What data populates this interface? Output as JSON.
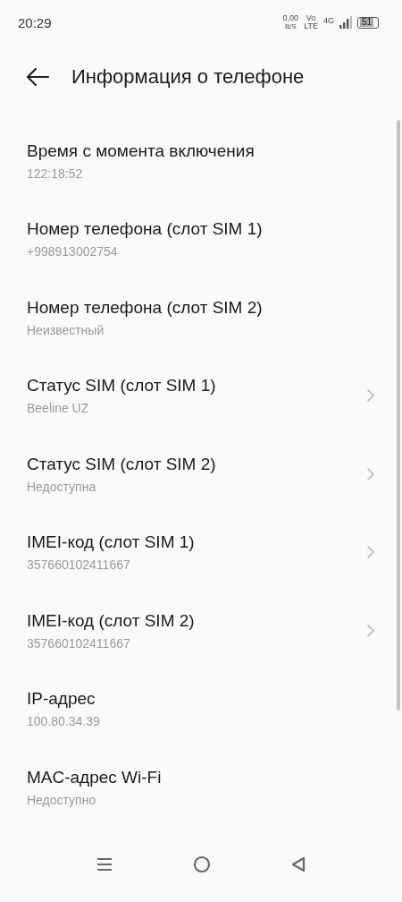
{
  "status_bar": {
    "time": "20:29",
    "speed_value": "0,00",
    "speed_unit": "B/S",
    "volte_top": "Vo",
    "volte_bottom": "LTE",
    "network": "4G",
    "battery": "51"
  },
  "header": {
    "title": "Информация о телефоне"
  },
  "items": [
    {
      "kind": "info",
      "title": "Время с момента включения",
      "value": "122:18:52"
    },
    {
      "kind": "info",
      "title": "Номер телефона (слот SIM 1)",
      "value": "+998913002754"
    },
    {
      "kind": "info",
      "title": "Номер телефона (слот SIM 2)",
      "value": "Неизвестный"
    },
    {
      "kind": "link",
      "title": "Статус SIM (слот SIM 1)",
      "value": "Beeline UZ"
    },
    {
      "kind": "link",
      "title": "Статус SIM (слот SIM 2)",
      "value": "Недоступна"
    },
    {
      "kind": "link",
      "title": "IMEI-код (слот SIM 1)",
      "value": "357660102411667"
    },
    {
      "kind": "link",
      "title": "IMEI-код (слот SIM 2)",
      "value": "357660102411667"
    },
    {
      "kind": "info",
      "title": "IP-адрес",
      "value": "100.80.34.39"
    },
    {
      "kind": "info",
      "title": "MAC-адрес Wi-Fi",
      "value": "Недоступно"
    }
  ]
}
